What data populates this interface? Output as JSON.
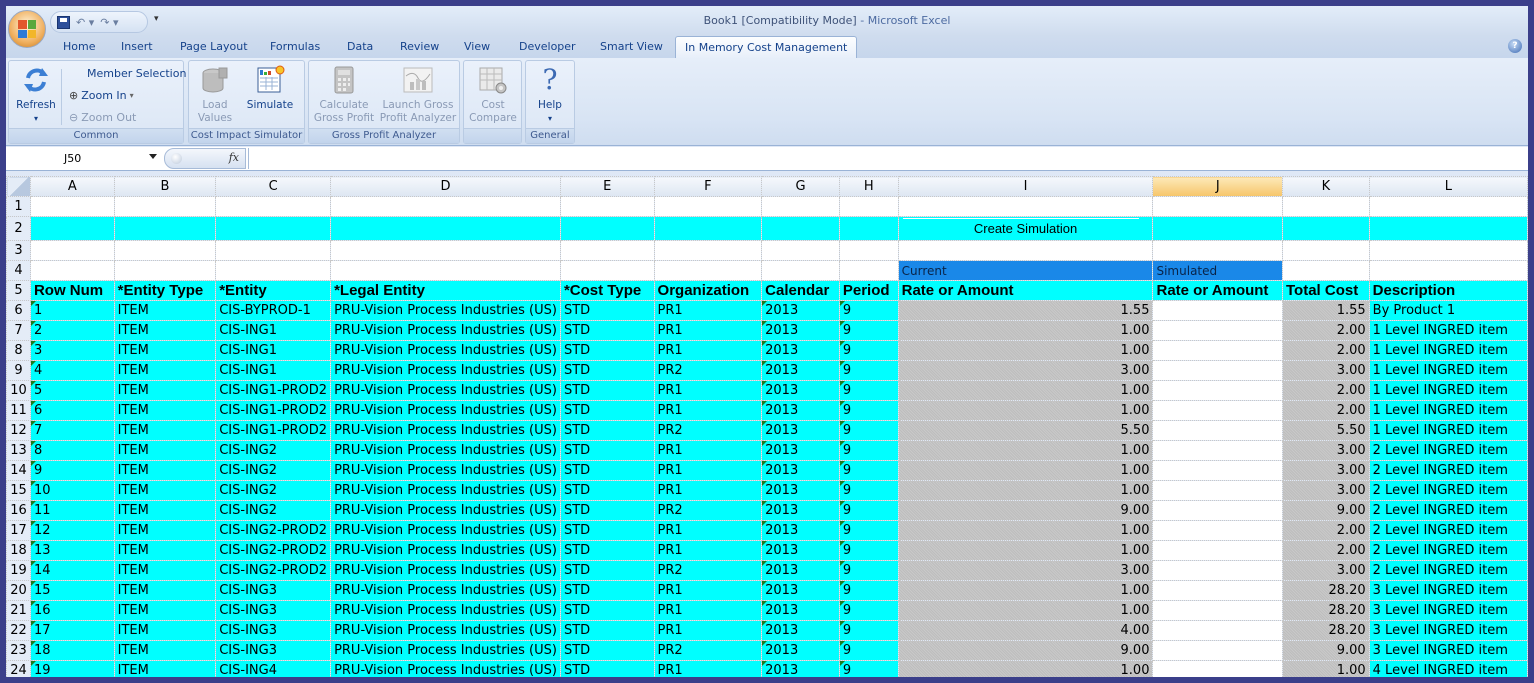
{
  "window": {
    "title": "Book1  [Compatibility Mode]",
    "app": " - Microsoft Excel"
  },
  "tabs": [
    {
      "label": "Home"
    },
    {
      "label": "Insert"
    },
    {
      "label": "Page Layout"
    },
    {
      "label": "Formulas"
    },
    {
      "label": "Data"
    },
    {
      "label": "Review"
    },
    {
      "label": "View"
    },
    {
      "label": "Developer"
    },
    {
      "label": "Smart View"
    },
    {
      "label": "In Memory Cost Management",
      "active": true
    }
  ],
  "ribbon": {
    "common": {
      "label": "Common",
      "refresh": "Refresh",
      "member_selection": "Member Selection",
      "zoom_in": "Zoom In",
      "zoom_out": "Zoom Out"
    },
    "cost_impact": {
      "label": "Cost Impact Simulator",
      "load_values_1": "Load",
      "load_values_2": "Values",
      "simulate": "Simulate"
    },
    "gross_profit": {
      "label": "Gross Profit Analyzer",
      "calculate_1": "Calculate",
      "calculate_2": "Gross Profit",
      "launch_1": "Launch Gross",
      "launch_2": "Profit Analyzer"
    },
    "cost_compare": {
      "label": "",
      "btn_1": "Cost",
      "btn_2": "Compare"
    },
    "general": {
      "label": "General",
      "help": "Help"
    }
  },
  "formula_bar": {
    "name_box": "J50",
    "fx": "fx",
    "formula": ""
  },
  "sheet": {
    "columns": [
      "A",
      "B",
      "C",
      "D",
      "E",
      "F",
      "G",
      "H",
      "I",
      "J",
      "K",
      "L"
    ],
    "selected_column": "J",
    "create_simulation": "Create Simulation",
    "current_label": "Current",
    "simulated_label": "Simulated",
    "headers": [
      "Row Num",
      "*Entity Type",
      "*Entity",
      "*Legal Entity",
      "*Cost Type",
      "Organization",
      "Calendar",
      "Period",
      "Rate or Amount",
      "Rate or Amount",
      "Total Cost",
      "Description"
    ],
    "rows": [
      {
        "row": 6,
        "num": "1",
        "type": "ITEM",
        "entity": "CIS-BYPROD-1",
        "legal": "PRU-Vision Process Industries (US)",
        "cost_type": "STD",
        "org": "PR1",
        "cal": "2013",
        "period": "9",
        "current": "1.55",
        "simulated": "",
        "total": "1.55",
        "desc": "By Product 1"
      },
      {
        "row": 7,
        "num": "2",
        "type": "ITEM",
        "entity": "CIS-ING1",
        "legal": "PRU-Vision Process Industries (US)",
        "cost_type": "STD",
        "org": "PR1",
        "cal": "2013",
        "period": "9",
        "current": "1.00",
        "simulated": "",
        "total": "2.00",
        "desc": "1 Level INGRED item"
      },
      {
        "row": 8,
        "num": "3",
        "type": "ITEM",
        "entity": "CIS-ING1",
        "legal": "PRU-Vision Process Industries (US)",
        "cost_type": "STD",
        "org": "PR1",
        "cal": "2013",
        "period": "9",
        "current": "1.00",
        "simulated": "",
        "total": "2.00",
        "desc": "1 Level INGRED item"
      },
      {
        "row": 9,
        "num": "4",
        "type": "ITEM",
        "entity": "CIS-ING1",
        "legal": "PRU-Vision Process Industries (US)",
        "cost_type": "STD",
        "org": "PR2",
        "cal": "2013",
        "period": "9",
        "current": "3.00",
        "simulated": "",
        "total": "3.00",
        "desc": "1 Level INGRED item"
      },
      {
        "row": 10,
        "num": "5",
        "type": "ITEM",
        "entity": "CIS-ING1-PROD2",
        "legal": "PRU-Vision Process Industries (US)",
        "cost_type": "STD",
        "org": "PR1",
        "cal": "2013",
        "period": "9",
        "current": "1.00",
        "simulated": "",
        "total": "2.00",
        "desc": "1 Level INGRED item"
      },
      {
        "row": 11,
        "num": "6",
        "type": "ITEM",
        "entity": "CIS-ING1-PROD2",
        "legal": "PRU-Vision Process Industries (US)",
        "cost_type": "STD",
        "org": "PR1",
        "cal": "2013",
        "period": "9",
        "current": "1.00",
        "simulated": "",
        "total": "2.00",
        "desc": "1 Level INGRED item"
      },
      {
        "row": 12,
        "num": "7",
        "type": "ITEM",
        "entity": "CIS-ING1-PROD2",
        "legal": "PRU-Vision Process Industries (US)",
        "cost_type": "STD",
        "org": "PR2",
        "cal": "2013",
        "period": "9",
        "current": "5.50",
        "simulated": "",
        "total": "5.50",
        "desc": "1 Level INGRED item"
      },
      {
        "row": 13,
        "num": "8",
        "type": "ITEM",
        "entity": "CIS-ING2",
        "legal": "PRU-Vision Process Industries (US)",
        "cost_type": "STD",
        "org": "PR1",
        "cal": "2013",
        "period": "9",
        "current": "1.00",
        "simulated": "",
        "total": "3.00",
        "desc": "2 Level INGRED item"
      },
      {
        "row": 14,
        "num": "9",
        "type": "ITEM",
        "entity": "CIS-ING2",
        "legal": "PRU-Vision Process Industries (US)",
        "cost_type": "STD",
        "org": "PR1",
        "cal": "2013",
        "period": "9",
        "current": "1.00",
        "simulated": "",
        "total": "3.00",
        "desc": "2 Level INGRED item"
      },
      {
        "row": 15,
        "num": "10",
        "type": "ITEM",
        "entity": "CIS-ING2",
        "legal": "PRU-Vision Process Industries (US)",
        "cost_type": "STD",
        "org": "PR1",
        "cal": "2013",
        "period": "9",
        "current": "1.00",
        "simulated": "",
        "total": "3.00",
        "desc": "2 Level INGRED item"
      },
      {
        "row": 16,
        "num": "11",
        "type": "ITEM",
        "entity": "CIS-ING2",
        "legal": "PRU-Vision Process Industries (US)",
        "cost_type": "STD",
        "org": "PR2",
        "cal": "2013",
        "period": "9",
        "current": "9.00",
        "simulated": "",
        "total": "9.00",
        "desc": "2 Level INGRED item"
      },
      {
        "row": 17,
        "num": "12",
        "type": "ITEM",
        "entity": "CIS-ING2-PROD2",
        "legal": "PRU-Vision Process Industries (US)",
        "cost_type": "STD",
        "org": "PR1",
        "cal": "2013",
        "period": "9",
        "current": "1.00",
        "simulated": "",
        "total": "2.00",
        "desc": "2 Level INGRED item"
      },
      {
        "row": 18,
        "num": "13",
        "type": "ITEM",
        "entity": "CIS-ING2-PROD2",
        "legal": "PRU-Vision Process Industries (US)",
        "cost_type": "STD",
        "org": "PR1",
        "cal": "2013",
        "period": "9",
        "current": "1.00",
        "simulated": "",
        "total": "2.00",
        "desc": "2 Level INGRED item"
      },
      {
        "row": 19,
        "num": "14",
        "type": "ITEM",
        "entity": "CIS-ING2-PROD2",
        "legal": "PRU-Vision Process Industries (US)",
        "cost_type": "STD",
        "org": "PR2",
        "cal": "2013",
        "period": "9",
        "current": "3.00",
        "simulated": "",
        "total": "3.00",
        "desc": "2 Level INGRED item"
      },
      {
        "row": 20,
        "num": "15",
        "type": "ITEM",
        "entity": "CIS-ING3",
        "legal": "PRU-Vision Process Industries (US)",
        "cost_type": "STD",
        "org": "PR1",
        "cal": "2013",
        "period": "9",
        "current": "1.00",
        "simulated": "",
        "total": "28.20",
        "desc": "3 Level INGRED item"
      },
      {
        "row": 21,
        "num": "16",
        "type": "ITEM",
        "entity": "CIS-ING3",
        "legal": "PRU-Vision Process Industries (US)",
        "cost_type": "STD",
        "org": "PR1",
        "cal": "2013",
        "period": "9",
        "current": "1.00",
        "simulated": "",
        "total": "28.20",
        "desc": "3 Level INGRED item"
      },
      {
        "row": 22,
        "num": "17",
        "type": "ITEM",
        "entity": "CIS-ING3",
        "legal": "PRU-Vision Process Industries (US)",
        "cost_type": "STD",
        "org": "PR1",
        "cal": "2013",
        "period": "9",
        "current": "4.00",
        "simulated": "",
        "total": "28.20",
        "desc": "3 Level INGRED item"
      },
      {
        "row": 23,
        "num": "18",
        "type": "ITEM",
        "entity": "CIS-ING3",
        "legal": "PRU-Vision Process Industries (US)",
        "cost_type": "STD",
        "org": "PR2",
        "cal": "2013",
        "period": "9",
        "current": "9.00",
        "simulated": "",
        "total": "9.00",
        "desc": "3 Level INGRED item"
      },
      {
        "row": 24,
        "num": "19",
        "type": "ITEM",
        "entity": "CIS-ING4",
        "legal": "PRU-Vision Process Industries (US)",
        "cost_type": "STD",
        "org": "PR1",
        "cal": "2013",
        "period": "9",
        "current": "1.00",
        "simulated": "",
        "total": "1.00",
        "desc": "4 Level INGRED item"
      }
    ]
  },
  "colors": {
    "cyan_fill": "#00ffff",
    "blue_fill": "#1a88e8",
    "gray_fill": "#c4c4c4",
    "selected_col": "#f6c56a"
  }
}
